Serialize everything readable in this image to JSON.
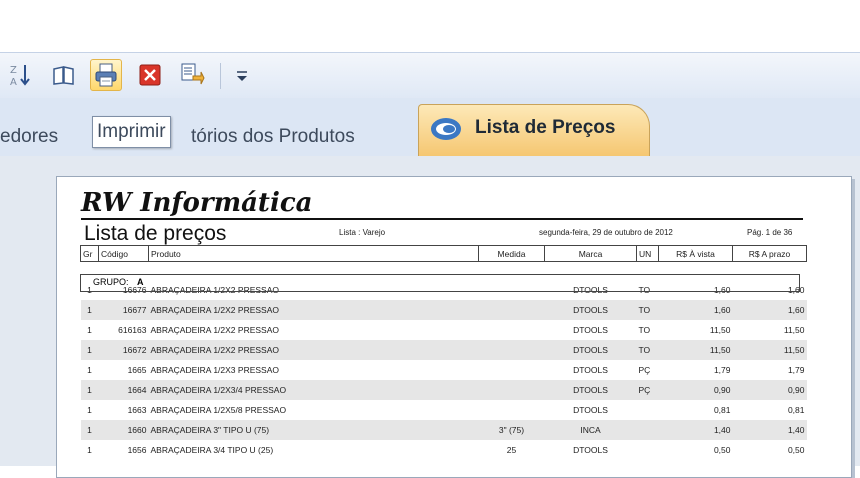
{
  "toolbar": {
    "buttons": [
      {
        "name": "sort-desc-icon",
        "glyph": "Z↓A"
      },
      {
        "name": "open-book-icon"
      },
      {
        "name": "print-icon",
        "active": true
      },
      {
        "name": "close-red-icon"
      },
      {
        "name": "export-icon"
      },
      {
        "name": "dropdown-icon",
        "glyph": "▾"
      }
    ]
  },
  "tabs": {
    "left_partial": "edores",
    "middle_partial": "tórios dos Produtos",
    "tooltip": "Imprimir",
    "active": "Lista de Preços"
  },
  "report": {
    "company": "RW Informática",
    "title": "Lista de preços",
    "filter": "Lista : Varejo",
    "date": "segunda-feira, 29 de outubro de 2012",
    "page": "Pág. 1 de 36",
    "headers": [
      "Gr",
      "Código",
      "Produto",
      "Medida",
      "Marca",
      "UN",
      "R$ À vista",
      "R$ A prazo"
    ],
    "group_label": "GRUPO:",
    "group_value": "A",
    "rows": [
      {
        "gr": "1",
        "codigo": "16676",
        "produto": "ABRAÇADEIRA 1/2X2 PRESSAO",
        "medida": "",
        "marca": "DTOOLS",
        "un": "TO",
        "vista": "1,60",
        "prazo": "1,60"
      },
      {
        "gr": "1",
        "codigo": "16677",
        "produto": "ABRAÇADEIRA 1/2X2 PRESSAO",
        "medida": "",
        "marca": "DTOOLS",
        "un": "TO",
        "vista": "1,60",
        "prazo": "1,60"
      },
      {
        "gr": "1",
        "codigo": "616163",
        "produto": "ABRAÇADEIRA 1/2X2 PRESSAO",
        "medida": "",
        "marca": "DTOOLS",
        "un": "TO",
        "vista": "11,50",
        "prazo": "11,50"
      },
      {
        "gr": "1",
        "codigo": "16672",
        "produto": "ABRAÇADEIRA 1/2X2 PRESSAO",
        "medida": "",
        "marca": "DTOOLS",
        "un": "TO",
        "vista": "11,50",
        "prazo": "11,50"
      },
      {
        "gr": "1",
        "codigo": "1665",
        "produto": "ABRAÇADEIRA 1/2X3 PRESSAO",
        "medida": "",
        "marca": "DTOOLS",
        "un": "PÇ",
        "vista": "1,79",
        "prazo": "1,79"
      },
      {
        "gr": "1",
        "codigo": "1664",
        "produto": "ABRAÇADEIRA 1/2X3/4 PRESSAO",
        "medida": "",
        "marca": "DTOOLS",
        "un": "PÇ",
        "vista": "0,90",
        "prazo": "0,90"
      },
      {
        "gr": "1",
        "codigo": "1663",
        "produto": "ABRAÇADEIRA 1/2X5/8 PRESSAO",
        "medida": "",
        "marca": "DTOOLS",
        "un": "",
        "vista": "0,81",
        "prazo": "0,81"
      },
      {
        "gr": "1",
        "codigo": "1660",
        "produto": "ABRAÇADEIRA 3\" TIPO U (75)",
        "medida": "3\" (75)",
        "marca": "INCA",
        "un": "",
        "vista": "1,40",
        "prazo": "1,40"
      },
      {
        "gr": "1",
        "codigo": "1656",
        "produto": "ABRAÇADEIRA 3/4 TIPO U (25)",
        "medida": "25",
        "marca": "DTOOLS",
        "un": "",
        "vista": "0,50",
        "prazo": "0,50"
      }
    ]
  }
}
